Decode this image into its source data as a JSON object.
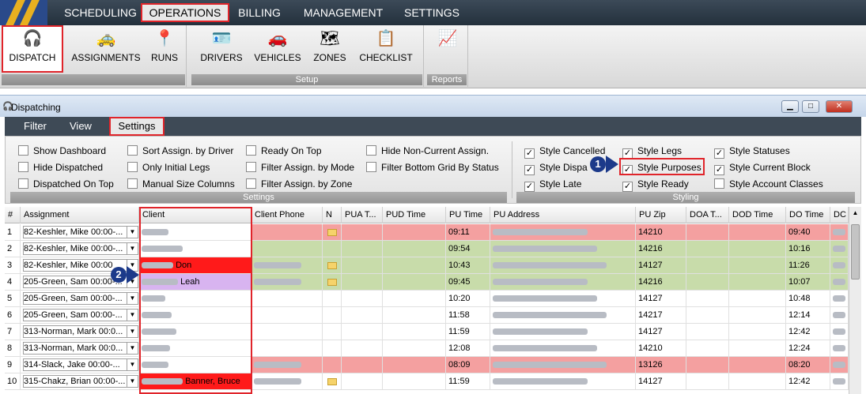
{
  "nav": {
    "tabs": [
      "SCHEDULING",
      "OPERATIONS",
      "BILLING",
      "MANAGEMENT",
      "SETTINGS"
    ]
  },
  "ribbon": {
    "dispatch_group": [
      "DISPATCH",
      "ASSIGNMENTS",
      "RUNS"
    ],
    "setup_group": [
      "DRIVERS",
      "VEHICLES",
      "ZONES",
      "CHECKLIST"
    ],
    "setup_label": "Setup",
    "reports_label": "Reports"
  },
  "window": {
    "title": "Dispatching"
  },
  "menu": {
    "filter": "Filter",
    "view": "View",
    "settings": "Settings"
  },
  "settings_options": {
    "col1": [
      "Show Dashboard",
      "Hide Dispatched",
      "Dispatched On Top"
    ],
    "col2": [
      "Sort Assign. by Driver",
      "Only Initial Legs",
      "Manual Size Columns"
    ],
    "col3": [
      "Ready On Top",
      "Filter Assign. by Mode",
      "Filter Assign. by Zone"
    ],
    "col4": [
      "Hide Non-Current Assign.",
      "Filter Bottom Grid By Status"
    ],
    "settings_label": "Settings",
    "styling_col1": [
      "Style Cancelled",
      "Style Dispa",
      "Style Late"
    ],
    "styling_col2": [
      "Style Legs",
      "Style Purposes",
      "Style Ready"
    ],
    "styling_col3": [
      "Style Statuses",
      "Style Current Block",
      "Style Account Classes"
    ],
    "styling_label": "Styling",
    "check_mark": "✓"
  },
  "callouts": {
    "one": "1",
    "two": "2"
  },
  "grid": {
    "headers": [
      "#",
      "Assignment",
      "Client",
      "Client Phone",
      "N",
      "PUA T...",
      "PUD Time",
      "PU Time",
      "PU Address",
      "PU Zip",
      "DOA T...",
      "DOD Time",
      "DO Time",
      "DC"
    ],
    "rows": [
      {
        "num": "1",
        "assignment": "82-Keshler, Mike 00:00-...",
        "client": "",
        "pu_time": "09:11",
        "pu_zip": "14210",
        "do_time": "09:40"
      },
      {
        "num": "2",
        "assignment": "82-Keshler, Mike 00:00-...",
        "client": "",
        "pu_time": "09:54",
        "pu_zip": "14216",
        "do_time": "10:16"
      },
      {
        "num": "3",
        "assignment": "82-Keshler, Mike 00:00",
        "client": "Don",
        "pu_time": "10:43",
        "pu_zip": "14127",
        "do_time": "11:26"
      },
      {
        "num": "4",
        "assignment": "205-Green, Sam 00:00-...",
        "client": "Leah",
        "pu_time": "09:45",
        "pu_zip": "14216",
        "do_time": "10:07"
      },
      {
        "num": "5",
        "assignment": "205-Green, Sam 00:00-...",
        "client": "",
        "pu_time": "10:20",
        "pu_zip": "14127",
        "do_time": "10:48"
      },
      {
        "num": "6",
        "assignment": "205-Green, Sam 00:00-...",
        "client": "",
        "pu_time": "11:58",
        "pu_zip": "14217",
        "do_time": "12:14"
      },
      {
        "num": "7",
        "assignment": "313-Norman, Mark 00:0...",
        "client": "",
        "pu_time": "11:59",
        "pu_zip": "14127",
        "do_time": "12:42"
      },
      {
        "num": "8",
        "assignment": "313-Norman, Mark 00:0...",
        "client": "",
        "pu_time": "12:08",
        "pu_zip": "14210",
        "do_time": "12:24"
      },
      {
        "num": "9",
        "assignment": "314-Slack, Jake 00:00-...",
        "client": "",
        "pu_time": "08:09",
        "pu_zip": "13126",
        "do_time": "08:20"
      },
      {
        "num": "10",
        "assignment": "315-Chakz, Brian 00:00-...",
        "client": "Banner, Bruce",
        "pu_time": "11:59",
        "pu_zip": "14127",
        "do_time": "12:42"
      }
    ]
  },
  "colors": {
    "red_highlight": "#e0242a",
    "row_red": "#f4a0a0",
    "row_green": "#c8dcaa",
    "client_red": "#ff1a1a",
    "client_purple": "#d8b4f0"
  }
}
